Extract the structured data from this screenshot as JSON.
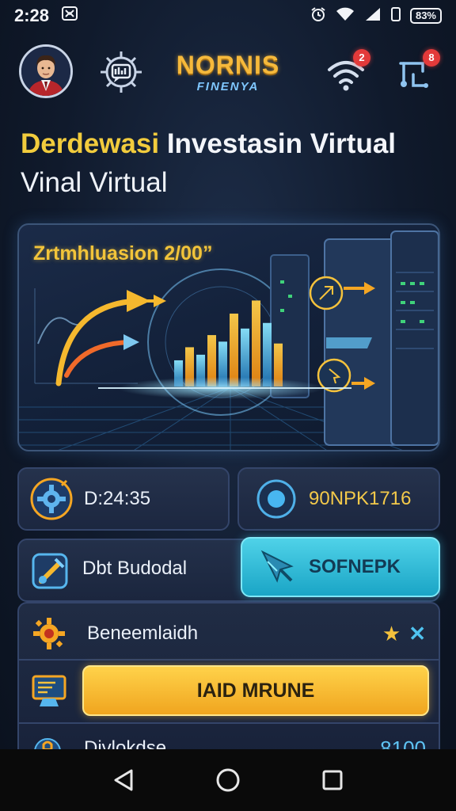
{
  "status_bar": {
    "time": "2:28",
    "notification_icon": "app-notification-icon",
    "battery": "83%"
  },
  "header": {
    "brand_name": "NORNIS",
    "brand_sub": "FINENYA",
    "wifi_badge": "2",
    "route_badge": "8"
  },
  "hero": {
    "headline_accent": "Derdewasi",
    "headline_rest": "Investasin Virtual",
    "subline": "Vinal Virtual"
  },
  "banner": {
    "title": "Zrtmhluasion 2/00”",
    "chart_bars": [
      0.28,
      0.42,
      0.34,
      0.55,
      0.48,
      0.78,
      0.62,
      0.92,
      0.68,
      0.46
    ]
  },
  "tiles": {
    "timer_value": "D:24:35",
    "code_value": "90NPK1716"
  },
  "actions": {
    "row_label": "Dbt Budodal",
    "cyan_button": "SOFNEPK"
  },
  "list": {
    "item1_label": "Beneemlaidh",
    "gold_button": "IAID MRUNE",
    "item3_label": "Divlokdse",
    "item3_value": "8100"
  },
  "colors": {
    "accent_gold": "#f2c43a",
    "accent_cyan": "#3fc7e3",
    "badge_red": "#e33a3a",
    "background": "#101a2c"
  }
}
